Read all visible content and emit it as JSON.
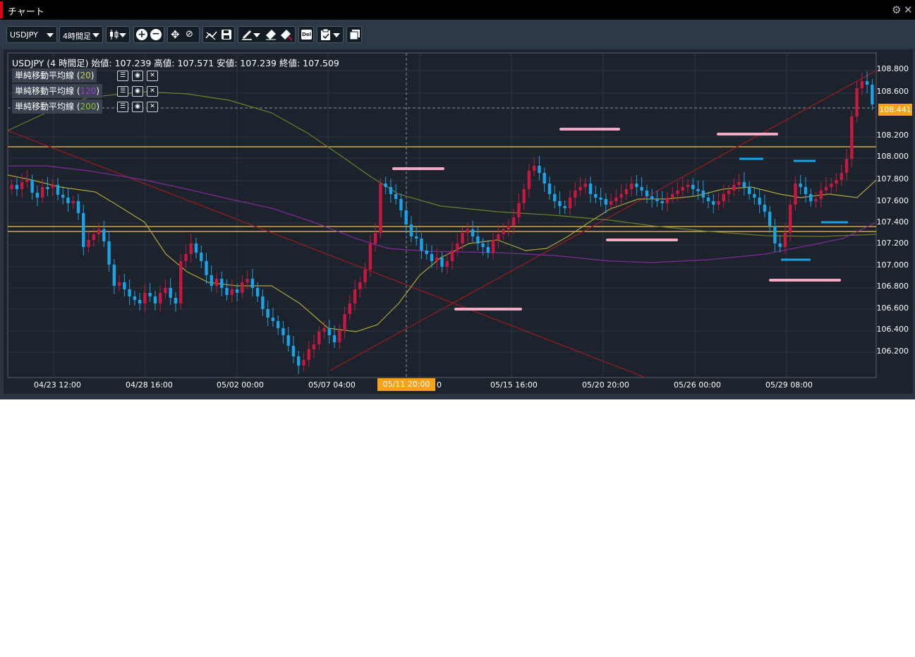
{
  "window": {
    "title": "チャート",
    "gear_icon": "gear-icon",
    "close_icon": "close-icon"
  },
  "toolbar": {
    "symbol": "USDJPY",
    "timeframe": "4時間足",
    "buttons": [
      "chart-type-icon",
      "zoom-in-icon",
      "zoom-out-icon",
      "move-icon",
      "reset-icon",
      "indicator-icon",
      "save-icon",
      "draw-icon",
      "eraser-icon",
      "eraser-all-icon",
      "delete-icon",
      "clipboard-icon",
      "window-icon"
    ],
    "delete_label": "Del"
  },
  "chart": {
    "info_line": "USDJPY (4 時間足) 始値: 107.239 高値: 107.571 安値: 107.239 終値: 107.509",
    "indicators": [
      {
        "label": "単純移動平均線 (",
        "period": "20",
        "close": ")",
        "color": "#c9c94a"
      },
      {
        "label": "単純移動平均線 (",
        "period": "120",
        "close": ")",
        "color": "#a23bd0"
      },
      {
        "label": "単純移動平均線 (",
        "period": "200",
        "close": ")",
        "color": "#86c232"
      }
    ],
    "current_price": "108.441",
    "current_time": "05/11 20:00",
    "y_labels": [
      "108.800",
      "108.600",
      "108.200",
      "108.000",
      "107.800",
      "107.600",
      "107.400",
      "107.200",
      "107.000",
      "106.800",
      "106.600",
      "106.400",
      "106.200"
    ],
    "x_labels": [
      "04/23 12:00",
      "04/28 16:00",
      "05/02 00:00",
      "05/07 04:00",
      "05/15 16:00",
      "05/20 20:00",
      "05/26 00:00",
      "05/29 08:00"
    ],
    "x_label_cut": "0",
    "colors": {
      "up": "#c8183f",
      "down": "#1aa3e6",
      "background": "#1c232d",
      "accent": "#f7a21b"
    }
  }
}
